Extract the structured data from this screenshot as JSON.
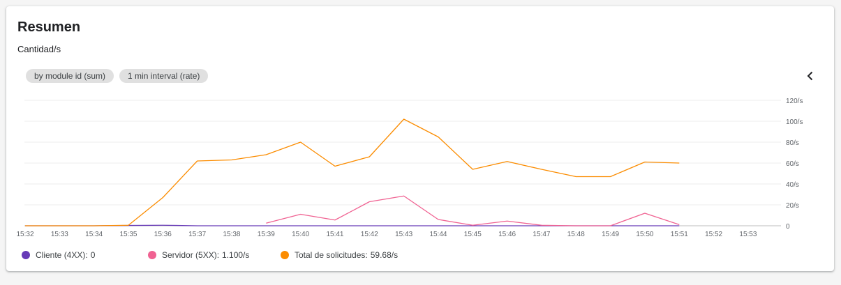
{
  "card": {
    "title": "Resumen",
    "subtitle": "Cantidad/s",
    "chips": [
      "by module id (sum)",
      "1 min interval (rate)"
    ]
  },
  "legend": [
    {
      "label": "Cliente (4XX):",
      "value": "0",
      "color": "#673ab7"
    },
    {
      "label": "Servidor (5XX):",
      "value": "1.100/s",
      "color": "#f06292"
    },
    {
      "label": "Total de solicitudes:",
      "value": "59.68/s",
      "color": "#fb8c00"
    }
  ],
  "chart_data": {
    "type": "line",
    "x": [
      "15:32",
      "15:33",
      "15:34",
      "15:35",
      "15:36",
      "15:37",
      "15:38",
      "15:39",
      "15:40",
      "15:41",
      "15:42",
      "15:43",
      "15:44",
      "15:45",
      "15:46",
      "15:47",
      "15:48",
      "15:49",
      "15:50",
      "15:51",
      "15:52",
      "15:53"
    ],
    "y_ticks": [
      "0",
      "20/s",
      "40/s",
      "60/s",
      "80/s",
      "100/s",
      "120/s"
    ],
    "ylim": [
      0,
      120
    ],
    "grid": true,
    "legend_position": "bottom",
    "series": [
      {
        "name": "Cliente (4XX)",
        "color": "#673ab7",
        "values": [
          0,
          0,
          0,
          0.3,
          0.5,
          0,
          0,
          0,
          0,
          0,
          0,
          0,
          0,
          0,
          0,
          0,
          0,
          0,
          0,
          0,
          null,
          null
        ]
      },
      {
        "name": "Servidor (5XX)",
        "color": "#f06292",
        "values": [
          null,
          null,
          null,
          null,
          null,
          null,
          null,
          2.5,
          11,
          5.5,
          23,
          28.5,
          6,
          0.5,
          4.5,
          0.5,
          0,
          0,
          12,
          1.1,
          null,
          null
        ]
      },
      {
        "name": "Total de solicitudes",
        "color": "#fb8c00",
        "values": [
          0,
          0,
          0,
          0.5,
          27,
          62,
          63,
          68,
          80,
          57,
          66,
          102,
          85,
          54,
          61.5,
          54,
          47,
          47,
          61,
          60,
          null,
          null
        ]
      }
    ]
  }
}
